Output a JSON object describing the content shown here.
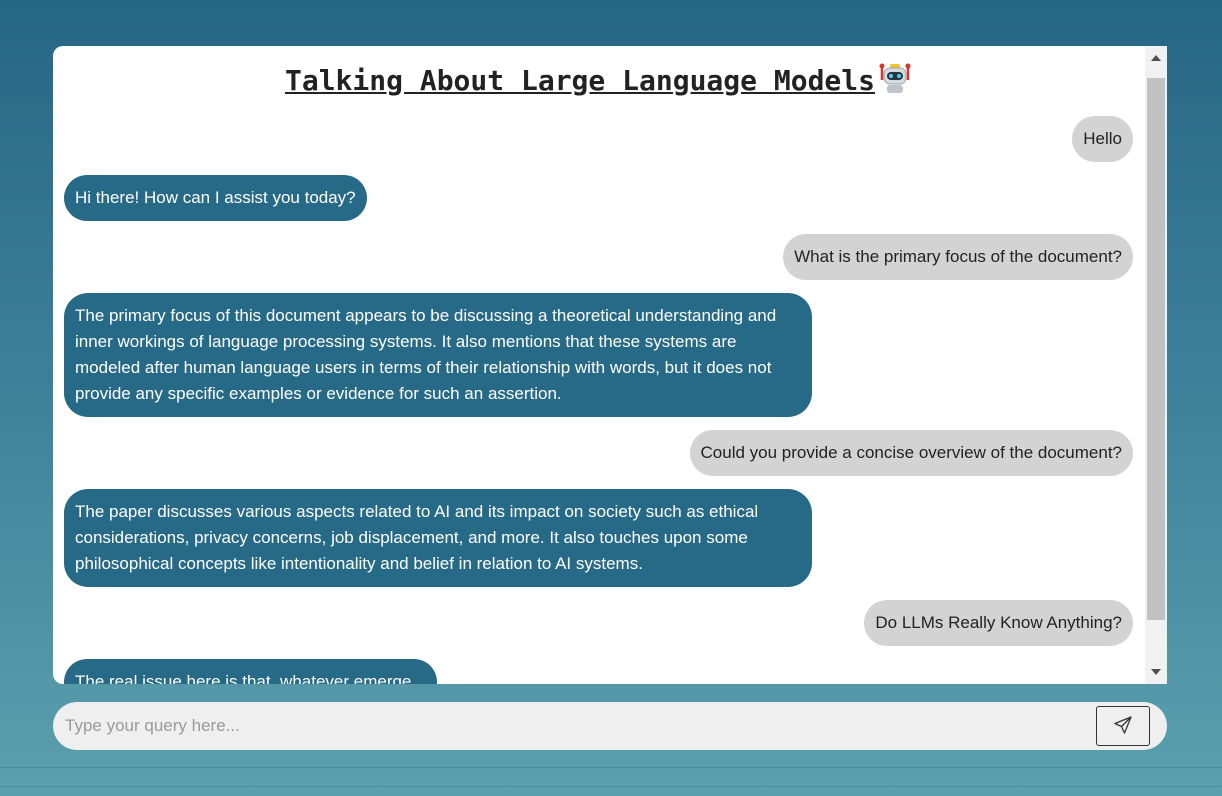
{
  "header": {
    "title": "Talking About Large Language Models"
  },
  "messages": [
    {
      "role": "user",
      "text": "Hello"
    },
    {
      "role": "bot",
      "text": "Hi there! How can I assist you today?"
    },
    {
      "role": "user",
      "text": "What is the primary focus of the document?"
    },
    {
      "role": "bot",
      "text": "The primary focus of this document appears to be discussing a theoretical understanding and inner workings of language processing systems. It also mentions that these systems are modeled after human language users in terms of their relationship with words, but it does not provide any specific examples or evidence for such an assertion."
    },
    {
      "role": "user",
      "text": "Could you provide a concise overview of the document?"
    },
    {
      "role": "bot",
      "text": "The paper discusses various aspects related to AI and its impact on society such as ethical considerations, privacy concerns, job displacement, and more. It also touches upon some philosophical concepts like intentionality and belief in relation to AI systems."
    },
    {
      "role": "user",
      "text": "Do LLMs Really Know Anything?"
    },
    {
      "role": "bot",
      "text": "The real issue here is that, whatever emerge..."
    }
  ],
  "input": {
    "placeholder": "Type your query here...",
    "value": ""
  },
  "icons": {
    "title_icon": "robot-icon",
    "send_icon": "send-icon"
  },
  "colors": {
    "bot_bubble": "#266a87",
    "user_bubble": "#d3d3d3",
    "background_top": "#266685",
    "background_bottom": "#5ba0ae"
  }
}
